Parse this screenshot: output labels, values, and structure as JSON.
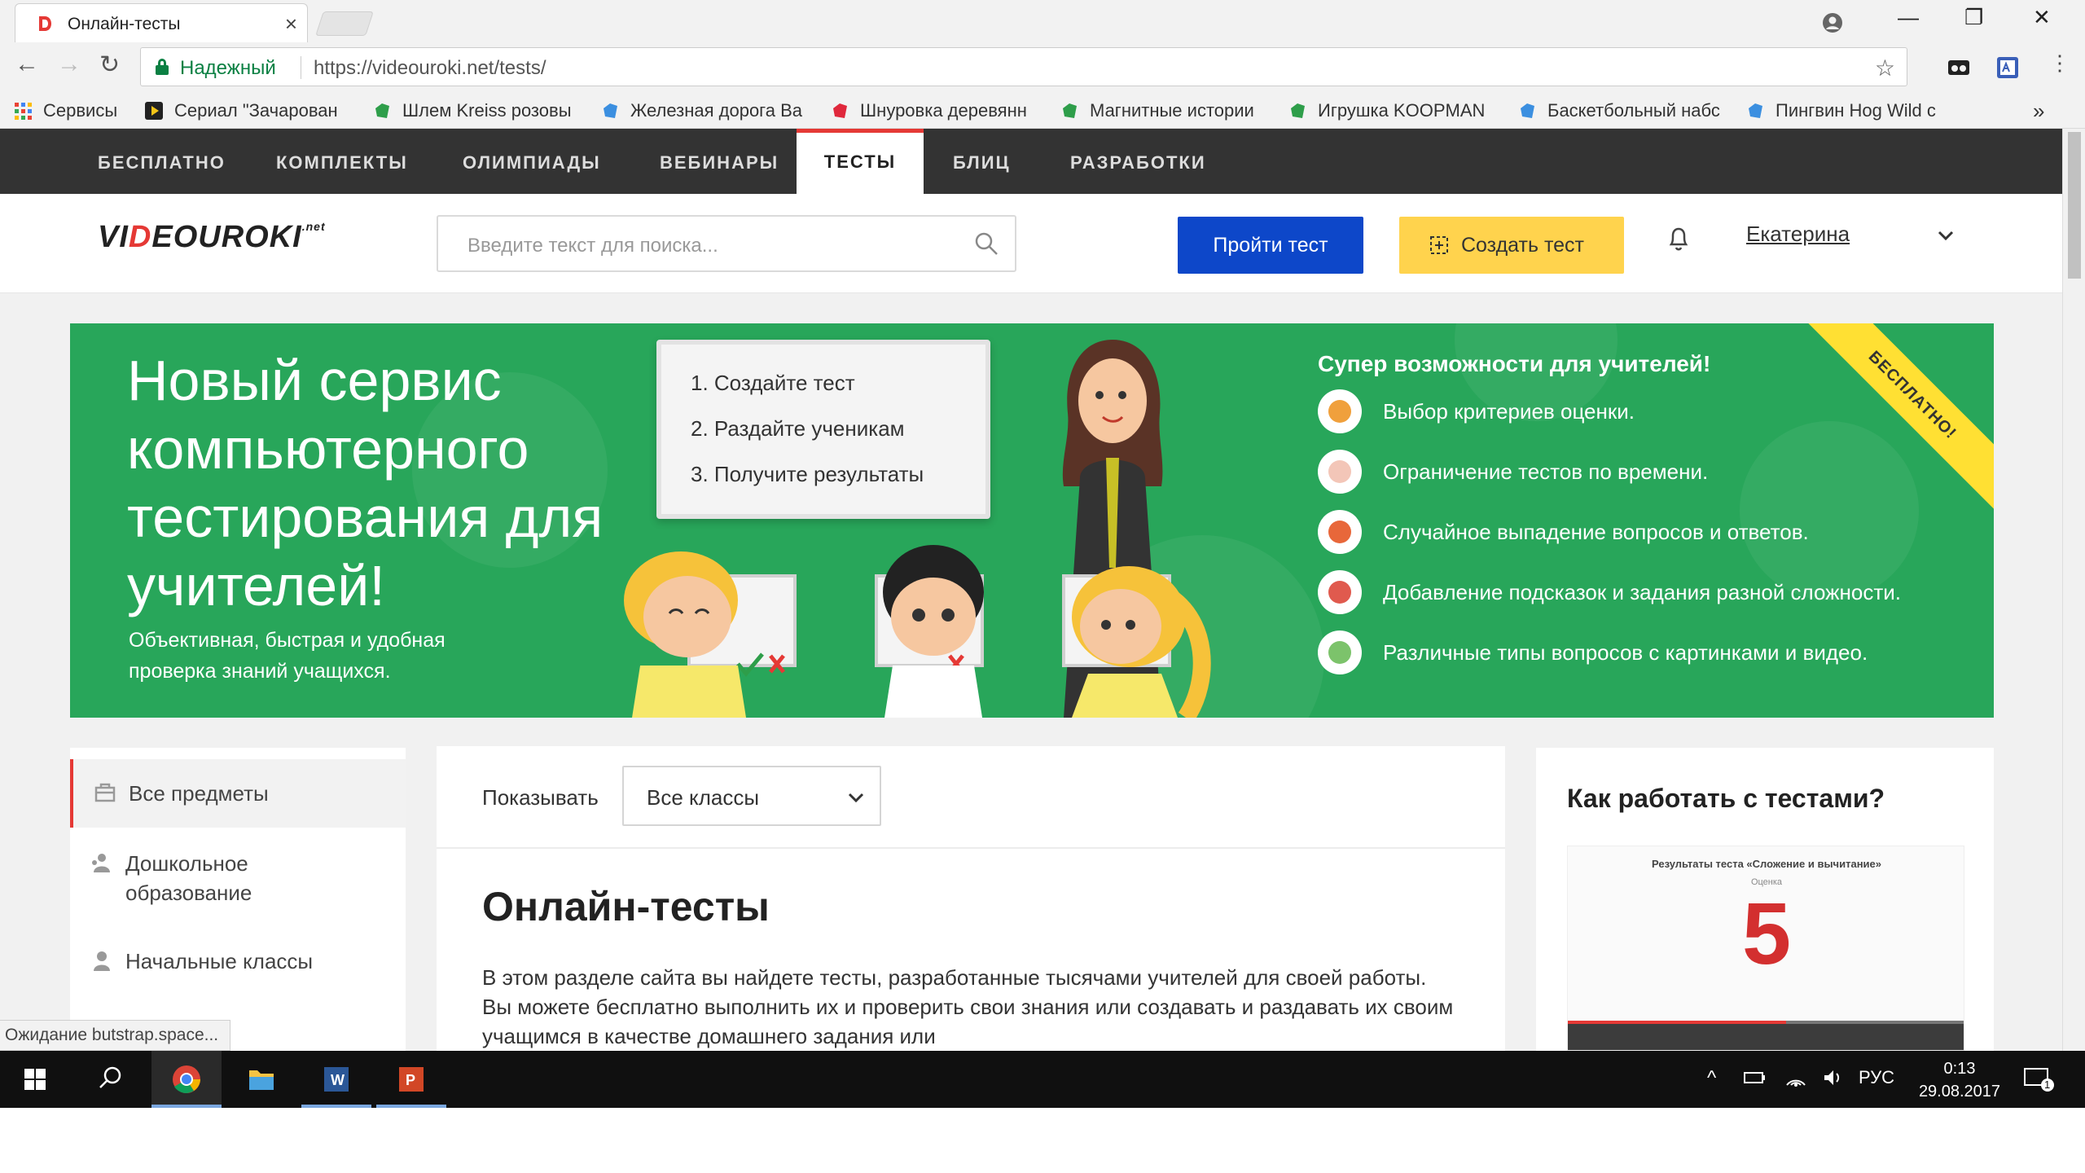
{
  "browser": {
    "tab_title": "Онлайн-тесты",
    "tab_close": "×",
    "secure_label": "Надежный",
    "url": "https://videouroki.net/tests/",
    "nav_back": "←",
    "nav_forward": "→",
    "nav_reload": "↻",
    "star": "☆",
    "window_controls": [
      "⊖",
      "—",
      "❐",
      "✕"
    ],
    "bookmarks_more": "»"
  },
  "bookmarks": [
    {
      "label": "Сервисы",
      "icon": "apps-grid-icon",
      "color": "#4285f4"
    },
    {
      "label": "Сериал \"Зачарован",
      "icon": "play-icon",
      "color": "#222222"
    },
    {
      "label": "Шлем Kreiss розовы",
      "icon": "tag-icon",
      "color": "#2e9e4a"
    },
    {
      "label": "Железная дорога Ва",
      "icon": "tag-icon",
      "color": "#3b8fe0"
    },
    {
      "label": "Шнуровка деревянн",
      "icon": "tag-icon",
      "color": "#e0283c"
    },
    {
      "label": "Магнитные истории",
      "icon": "tag-icon",
      "color": "#2e9e4a"
    },
    {
      "label": "Игрушка KOOPMAN",
      "icon": "tag-icon",
      "color": "#2e9e4a"
    },
    {
      "label": "Баскетбольный набс",
      "icon": "tag-icon",
      "color": "#3b8fe0"
    },
    {
      "label": "Пингвин Hog Wild с",
      "icon": "tag-icon",
      "color": "#3b8fe0"
    }
  ],
  "nav": {
    "items": [
      {
        "label": "БЕСПЛАТНО",
        "active": false
      },
      {
        "label": "КОМПЛЕКТЫ",
        "active": false
      },
      {
        "label": "ОЛИМПИАДЫ",
        "active": false
      },
      {
        "label": "ВЕБИНАРЫ",
        "active": false
      },
      {
        "label": "ТЕСТЫ",
        "active": true
      },
      {
        "label": "БЛИЦ",
        "active": false
      },
      {
        "label": "РАЗРАБОТКИ",
        "active": false
      }
    ]
  },
  "header": {
    "logo_part1": "VI",
    "logo_part2": "D",
    "logo_part3": "EOUROKI",
    "logo_suffix": ".net",
    "search_placeholder": "Введите текст для поиска...",
    "take_test": "Пройти тест",
    "create_test": "Создать тест",
    "user_name": "Екатерина",
    "user_chevron": "⌄"
  },
  "banner": {
    "title": "Новый сервис компьютерного тестирования для учителей!",
    "subtitle": "Объективная, быстрая и удобная проверка знаний учащихся.",
    "steps": [
      "1. Создайте тест",
      "2. Раздайте ученикам",
      "3. Получите результаты"
    ],
    "perks_title": "Супер возможности для учителей!",
    "perks": [
      {
        "label": "Выбор критериев оценки.",
        "icon": "thumbs-up-icon",
        "color": "#f0a03c"
      },
      {
        "label": "Ограничение тестов по времени.",
        "icon": "clock-icon",
        "color": "#f3c6b8"
      },
      {
        "label": "Случайное выпадение вопросов и ответов.",
        "icon": "dice-icon",
        "color": "#e8673a"
      },
      {
        "label": "Добавление подсказок и задания разной сложности.",
        "icon": "compass-icon",
        "color": "#e05a4e"
      },
      {
        "label": "Различные типы вопросов с картинками и видео.",
        "icon": "picture-icon",
        "color": "#7cc36b"
      }
    ],
    "ribbon": "БЕСПЛАТНО!"
  },
  "sidebar": {
    "items": [
      {
        "label": "Все предметы",
        "icon": "subjects-icon",
        "active": true
      },
      {
        "label": "Дошкольное образование",
        "icon": "preschool-icon",
        "active": false
      },
      {
        "label": "Начальные классы",
        "icon": "primary-school-icon",
        "active": false
      }
    ]
  },
  "main": {
    "show_label": "Показывать",
    "grade_value": "Все классы",
    "grade_chevron": "⌄",
    "title": "Онлайн-тесты",
    "description": "В этом разделе сайта вы найдете тесты, разработанные тысячами учителей для своей работы. Вы можете бесплатно выполнить их и проверить свои знания или создавать и раздавать их своим учащимся в качестве домашнего задания или"
  },
  "howto": {
    "title": "Как работать с тестами?",
    "video_caption": "Результаты теста «Сложение и вычитание»",
    "video_sub": "Оценка",
    "video_score": "5",
    "video_progress": 0.55
  },
  "status": {
    "text": "Ожидание butstrap.space..."
  },
  "taskbar": {
    "apps": [
      {
        "name": "start-button",
        "active": false
      },
      {
        "name": "search-button",
        "active": false
      },
      {
        "name": "chrome-app",
        "active": true
      },
      {
        "name": "explorer-app",
        "active": false
      },
      {
        "name": "word-app",
        "active": false
      },
      {
        "name": "powerpoint-app",
        "active": false
      }
    ],
    "lang": "РУС",
    "time": "0:13",
    "date": "29.08.2017",
    "notif_count": "1",
    "tray_chevron": "^"
  }
}
